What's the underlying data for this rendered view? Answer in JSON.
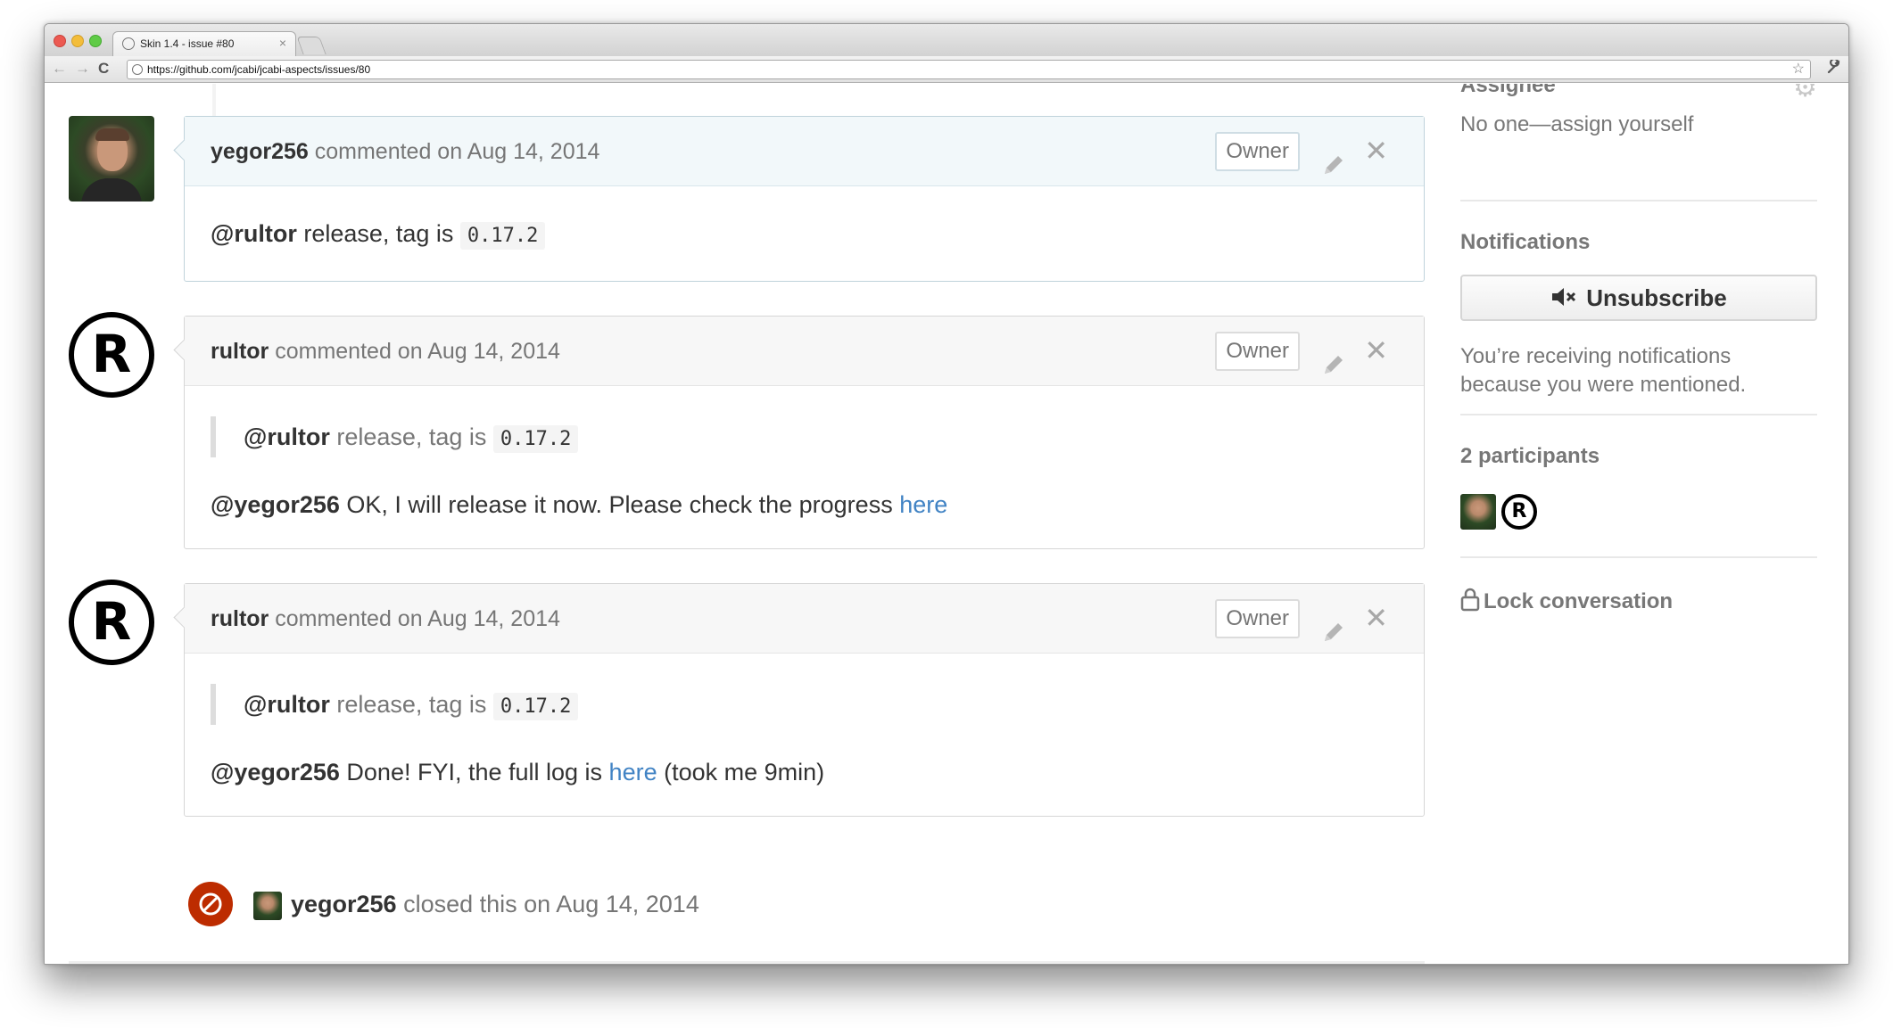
{
  "browser": {
    "tab_title": "Skin 1.4 - issue #80",
    "tab_close": "×",
    "url": "https://github.com/jcabi/jcabi-aspects/issues/80",
    "nav_back": "←",
    "nav_forward": "→",
    "nav_reload": "C",
    "star": "☆",
    "wrench": "🔧"
  },
  "comments": [
    {
      "author": "yegor256",
      "action": " commented on Aug 14, 2014",
      "badge": "Owner",
      "body_mention": "@rultor",
      "body_text": " release, tag is ",
      "body_code": "0.17.2"
    },
    {
      "author": "rultor",
      "action": " commented on Aug 14, 2014",
      "badge": "Owner",
      "quote_mention": "@rultor",
      "quote_text": " release, tag is ",
      "quote_code": "0.17.2",
      "reply_mention": "@yegor256",
      "reply_text": " OK, I will release it now. Please check the progress ",
      "reply_link": "here",
      "reply_after": ""
    },
    {
      "author": "rultor",
      "action": " commented on Aug 14, 2014",
      "badge": "Owner",
      "quote_mention": "@rultor",
      "quote_text": " release, tag is ",
      "quote_code": "0.17.2",
      "reply_mention": "@yegor256",
      "reply_text": " Done! FYI, the full log is ",
      "reply_link": "here",
      "reply_after": " (took me 9min)"
    }
  ],
  "closed_event": {
    "author": "yegor256",
    "text": " closed this on Aug 14, 2014"
  },
  "sidebar": {
    "assignee_heading": "Assignee",
    "assignee_text": "No one—assign yourself",
    "notifications_heading": "Notifications",
    "unsubscribe_label": "Unsubscribe",
    "notifications_reason_1": "You’re receiving notifications",
    "notifications_reason_2": "because you were mentioned.",
    "participants_heading": "2 participants",
    "lock_label": "Lock conversation"
  },
  "avatar_letter": "R",
  "colors": {
    "link": "#4183c4",
    "closed_red": "#bd2c00",
    "current_header": "#f2f8fa"
  }
}
